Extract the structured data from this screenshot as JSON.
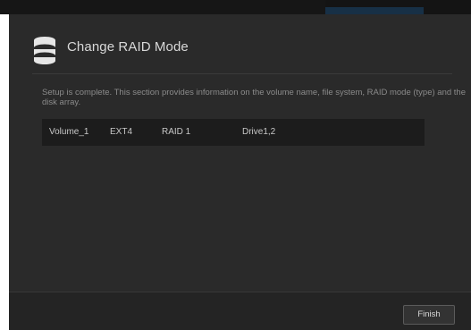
{
  "dialog": {
    "title": "Change RAID Mode",
    "icon": "database-icon",
    "description": "Setup is complete. This section provides information on the volume name, file system, RAID mode (type) and the disk array.",
    "volume": {
      "name": "Volume_1",
      "file_system": "EXT4",
      "raid_mode": "RAID 1",
      "disks": "Drive1,2"
    },
    "finish_label": "Finish"
  },
  "colors": {
    "dialog_background": "#2a2a2a",
    "row_background": "#1c1c1c",
    "title_text": "#d8d8d8",
    "description_text": "#8b8b8b",
    "top_bar_highlight": "#173046"
  }
}
